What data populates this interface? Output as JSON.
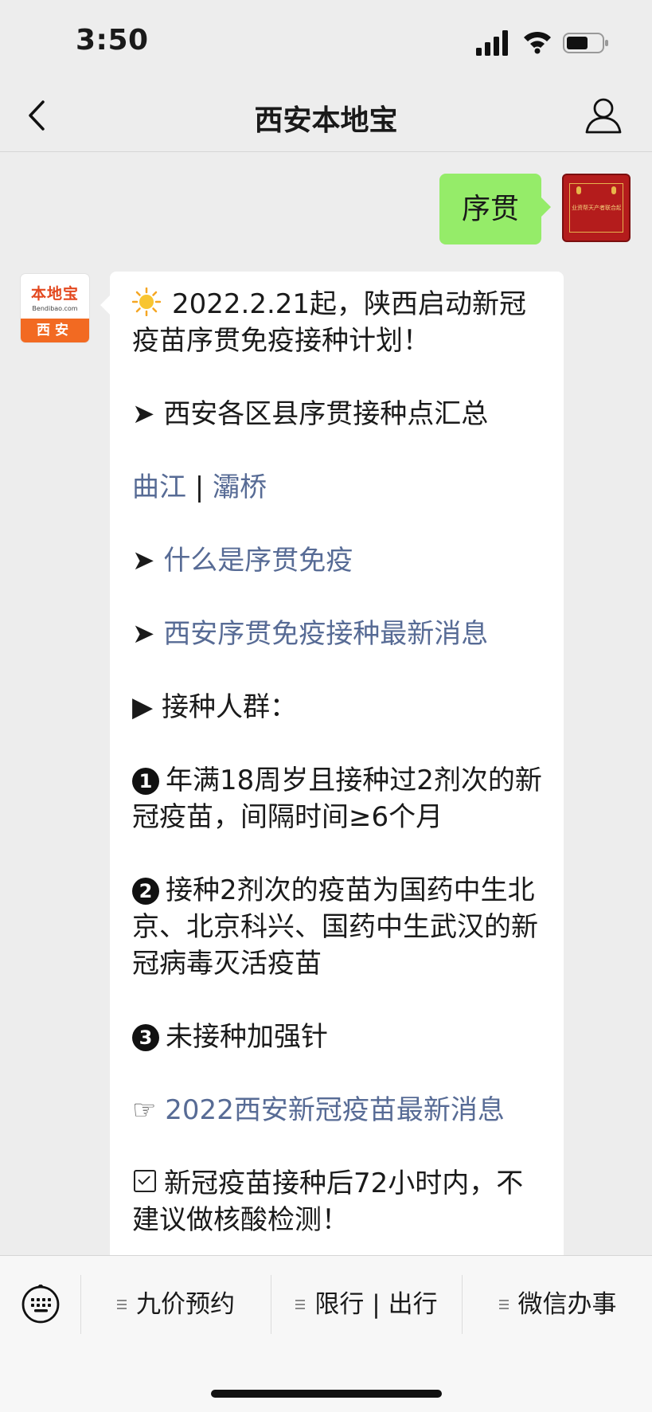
{
  "status": {
    "time": "3:50"
  },
  "nav": {
    "title": "西安本地宝"
  },
  "my_message": {
    "text": "序贯",
    "avatar_text": "业资帮天产者联合起来"
  },
  "bot": {
    "avatar_logo": "本地宝",
    "avatar_sub": "Bendibao.com",
    "avatar_city": "西安",
    "msg": {
      "title": "2022.2.21起，陕西启动新冠疫苗序贯免疫接种计划！",
      "arrow": "➤",
      "summary": "西安各区县序贯接种点汇总",
      "district_links": [
        "曲江",
        "灞桥"
      ],
      "sep": " | ",
      "link_what": "什么是序贯免疫",
      "link_latest": "西安序贯免疫接种最新消息",
      "triangle": "▶",
      "crowd_label": "接种人群：",
      "items": [
        {
          "num": "1",
          "text": "年满18周岁且接种过2剂次的新冠疫苗，间隔时间≥6个月"
        },
        {
          "num": "2",
          "text": "接种2剂次的疫苗为国药中生北京、北京科兴、国药中生武汉的新冠病毒灭活疫苗"
        },
        {
          "num": "3",
          "text": "未接种加强针"
        }
      ],
      "hand": "☞",
      "link_news": "2022西安新冠疫苗最新消息",
      "after_text": "新冠疫苗接种后72小时内，不建议做核酸检测！"
    }
  },
  "menu": {
    "items": [
      "九价预约",
      "限行 | 出行",
      "微信办事"
    ]
  }
}
